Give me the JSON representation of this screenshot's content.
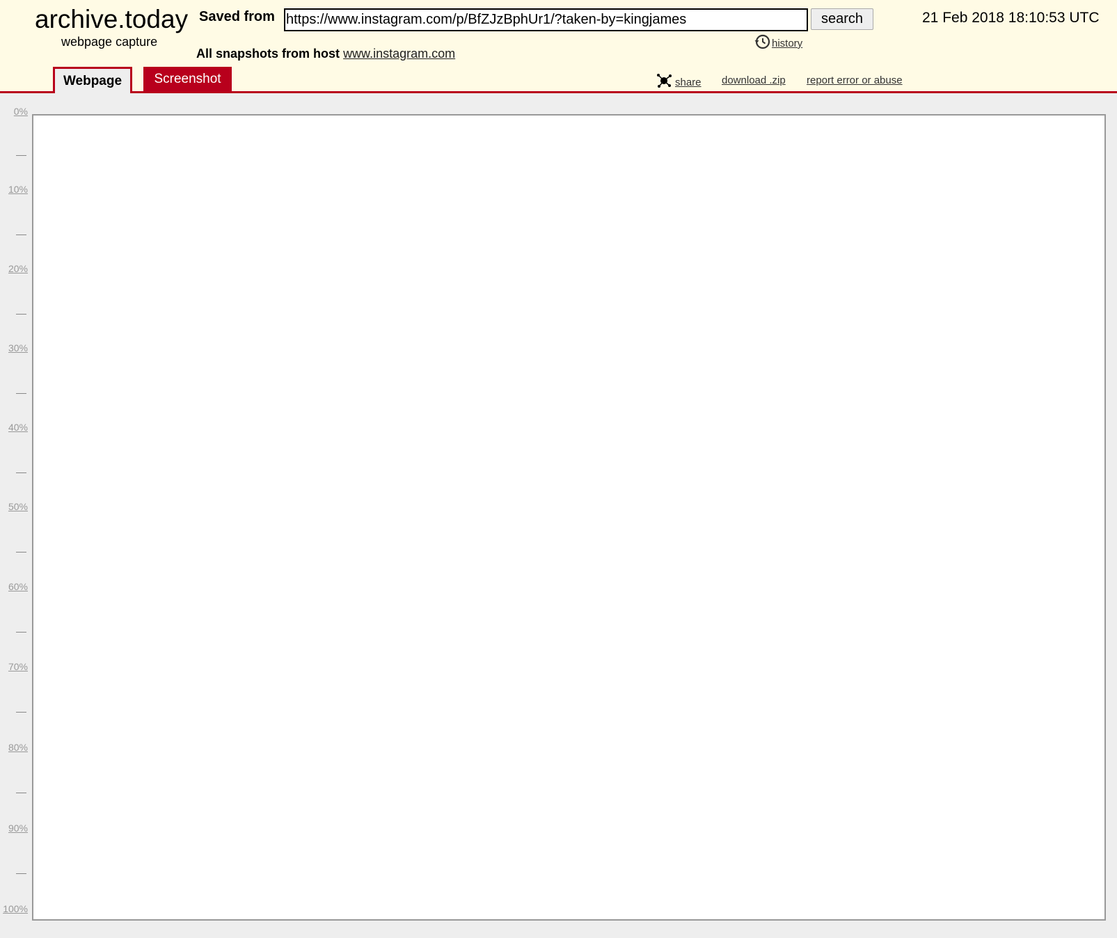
{
  "header": {
    "logo_title": "archive.today",
    "logo_subtitle": "webpage capture",
    "saved_from_label": "Saved from",
    "url_value": "https://www.instagram.com/p/BfZJzBphUr1/?taken-by=kingjames",
    "search_label": "search",
    "history_label": "history",
    "timestamp": "21 Feb 2018 18:10:53 UTC",
    "all_snapshots_label": "All snapshots",
    "from_host_label": "from host",
    "host_link": "www.instagram.com"
  },
  "tabs": {
    "webpage": "Webpage",
    "screenshot": "Screenshot"
  },
  "actions": {
    "share": "share",
    "download": "download .zip",
    "report": "report error or abuse"
  },
  "ruler": {
    "labels": [
      "0%",
      "10%",
      "20%",
      "30%",
      "40%",
      "50%",
      "60%",
      "70%",
      "80%",
      "90%",
      "100%"
    ]
  },
  "colors": {
    "header_bg": "#fffbe5",
    "accent": "#b8001c",
    "page_bg": "#eeeeee"
  }
}
